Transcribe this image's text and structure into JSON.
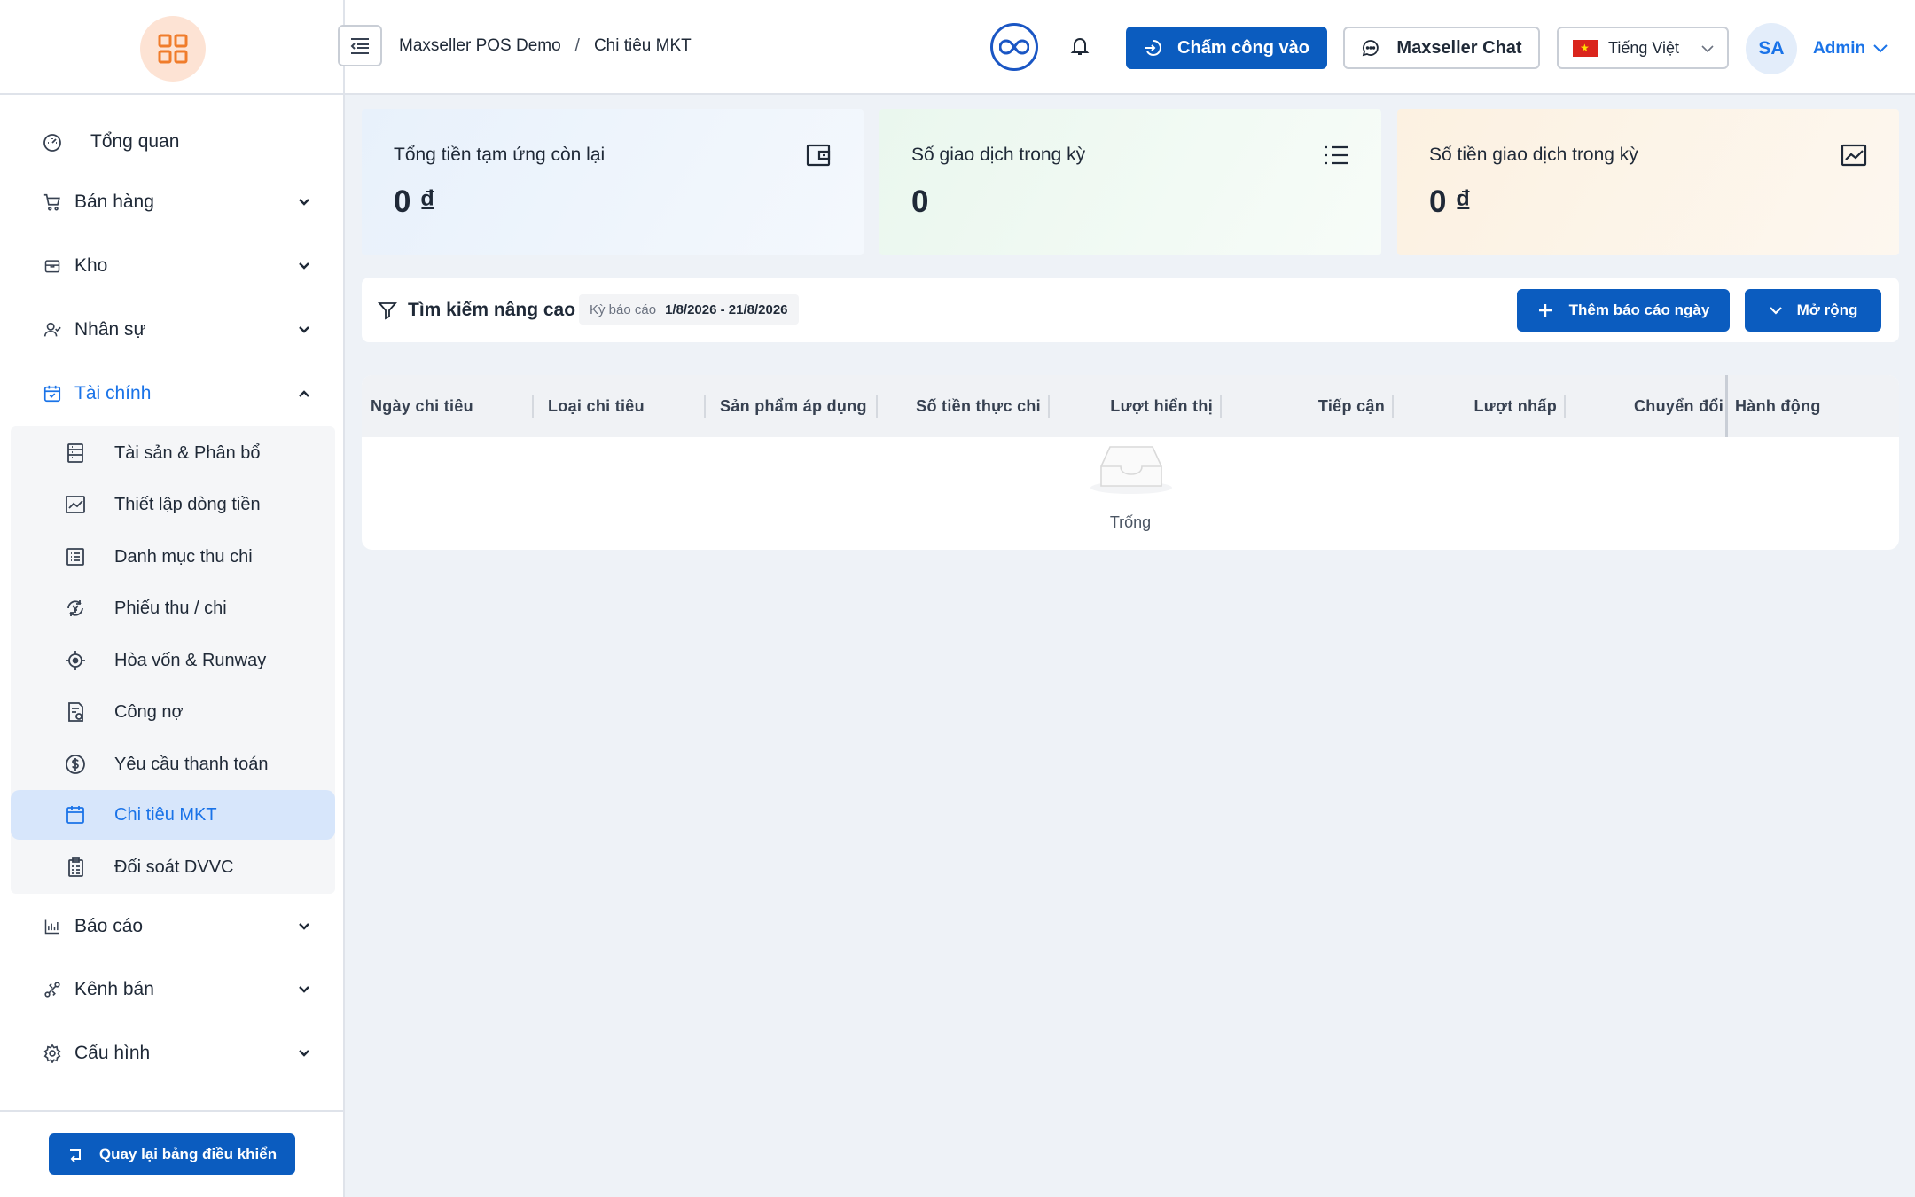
{
  "sidebar": {
    "items": [
      {
        "label": "Tổng quan",
        "icon": "dashboard-icon"
      },
      {
        "label": "Bán hàng",
        "icon": "cart-icon"
      },
      {
        "label": "Kho",
        "icon": "box-icon"
      },
      {
        "label": "Nhân sự",
        "icon": "users-icon"
      },
      {
        "label": "Tài chính",
        "icon": "finance-icon"
      },
      {
        "label": "Báo cáo",
        "icon": "bar-chart-icon"
      },
      {
        "label": "Kênh bán",
        "icon": "link-icon"
      },
      {
        "label": "Cấu hình",
        "icon": "gear-icon"
      }
    ],
    "sub_items": [
      {
        "label": "Tài sản & Phân bổ",
        "icon": "ledger-icon"
      },
      {
        "label": "Thiết lập dòng tiền",
        "icon": "trend-icon"
      },
      {
        "label": "Danh mục thu chi",
        "icon": "list-doc-icon"
      },
      {
        "label": "Phiếu thu / chi",
        "icon": "exchange-icon"
      },
      {
        "label": "Hòa vốn & Runway",
        "icon": "target-icon"
      },
      {
        "label": "Công nợ",
        "icon": "debt-doc-icon"
      },
      {
        "label": "Yêu cầu thanh toán",
        "icon": "dollar-icon"
      },
      {
        "label": "Chi tiêu MKT",
        "icon": "calendar-icon"
      },
      {
        "label": "Đối soát DVVC",
        "icon": "reconcile-icon"
      }
    ],
    "back_button": "Quay lại bảng điều khiển"
  },
  "header": {
    "breadcrumb": [
      "Maxseller POS Demo",
      "/",
      "Chi tiêu MKT"
    ],
    "checkin_label": "Chấm công vào",
    "chat_label": "Maxseller Chat",
    "language": "Tiếng Việt",
    "avatar_initials": "SA",
    "user_name": "Admin"
  },
  "stats": [
    {
      "title": "Tổng tiền tạm ứng còn lại",
      "value": "0 ₫",
      "icon": "wallet-icon"
    },
    {
      "title": "Số giao dịch trong kỳ",
      "value": "0",
      "icon": "list-icon"
    },
    {
      "title": "Số tiền giao dịch trong kỳ",
      "value": "0 ₫",
      "icon": "chart-line-icon"
    }
  ],
  "filter": {
    "title": "Tìm kiếm nâng cao",
    "period_label": "Kỳ báo cáo",
    "period_value": "1/8/2026 - 21/8/2026",
    "add_button": "Thêm báo cáo ngày",
    "expand_button": "Mở rộng"
  },
  "table": {
    "columns": [
      "Ngày chi tiêu",
      "Loại chi tiêu",
      "Sản phẩm áp dụng",
      "Số tiền thực chi",
      "Lượt hiển thị",
      "Tiếp cận",
      "Lượt nhấp",
      "Chuyển đổi",
      "Hành động"
    ],
    "empty_text": "Trống"
  },
  "colors": {
    "primary": "#0b5cbf",
    "accent": "#1a73e8",
    "logo_bg": "#fde3d4",
    "logo_fg": "#f07c2b",
    "active_bg": "#d7e6fb"
  }
}
